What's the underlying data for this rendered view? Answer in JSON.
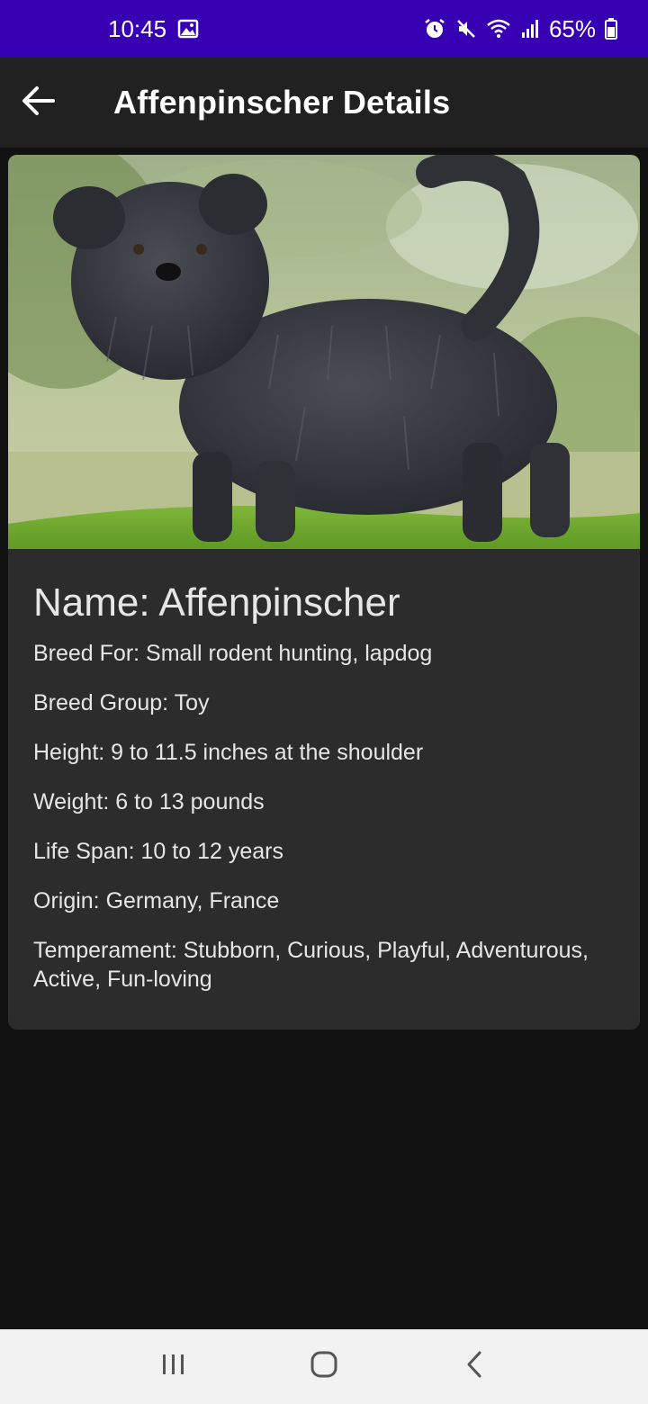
{
  "status_bar": {
    "time": "10:45",
    "battery": "65%",
    "icons": [
      "image-icon",
      "alarm-icon",
      "mute-icon",
      "wifi-icon",
      "signal-icon",
      "battery-icon"
    ]
  },
  "app_bar": {
    "title": "Affenpinscher Details",
    "back_icon": "arrow-back-icon"
  },
  "breed": {
    "photo_subject": "Affenpinscher",
    "name": "Name: Affenpinscher",
    "bred_for": "Breed For: Small rodent hunting, lapdog",
    "breed_group": "Breed Group: Toy",
    "height": "Height: 9 to 11.5 inches at the shoulder",
    "weight": "Weight: 6 to 13 pounds",
    "life_span": "Life Span: 10 to 12 years",
    "origin": "Origin: Germany, France",
    "temperament": "Temperament: Stubborn, Curious, Playful, Adventurous, Active, Fun-loving"
  },
  "nav_bar": {
    "icons": [
      "recents-icon",
      "home-icon",
      "back-icon"
    ]
  },
  "colors": {
    "status_bar": "#3700b3",
    "app_bar": "#212121",
    "background": "#121212",
    "card": "#2c2c2c",
    "nav_bar": "#f2f2f2"
  }
}
